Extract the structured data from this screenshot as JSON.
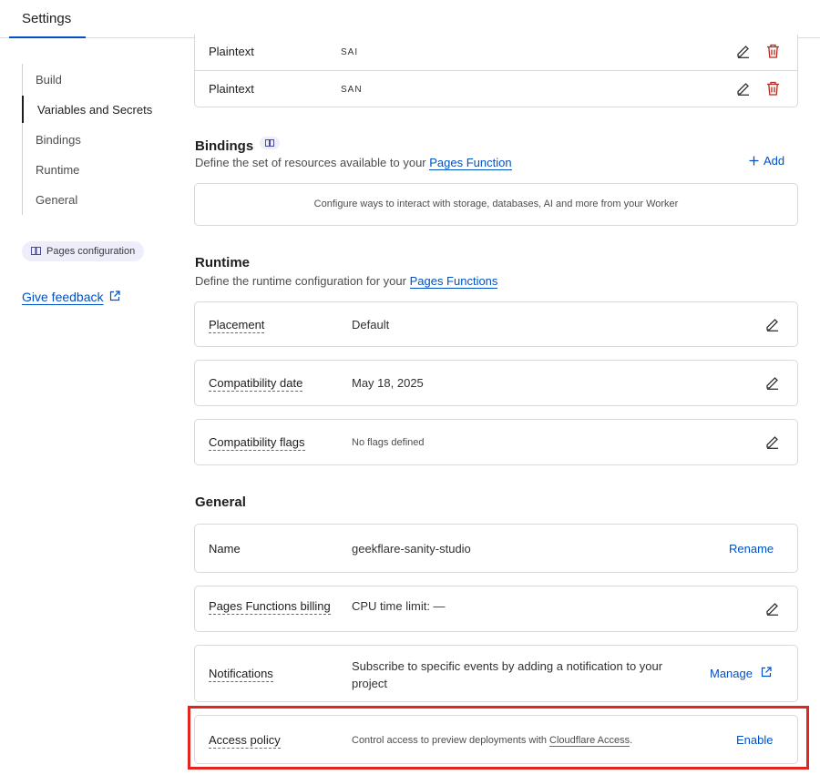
{
  "header": {
    "tab": "Settings"
  },
  "sidebar": {
    "items": [
      {
        "label": "Build",
        "active": false
      },
      {
        "label": "Variables and Secrets",
        "active": true
      },
      {
        "label": "Bindings",
        "active": false
      },
      {
        "label": "Runtime",
        "active": false
      },
      {
        "label": "General",
        "active": false
      }
    ],
    "pages_config": "Pages configuration",
    "feedback": "Give feedback"
  },
  "variables": [
    {
      "type": "Plaintext",
      "name": "SAI"
    },
    {
      "type": "Plaintext",
      "name": "SAN"
    }
  ],
  "bindings": {
    "title": "Bindings",
    "desc_prefix": "Define the set of resources available to your ",
    "desc_link": "Pages Function",
    "add": "Add",
    "empty": "Configure ways to interact with storage, databases, AI and more from your Worker"
  },
  "runtime": {
    "title": "Runtime",
    "desc_prefix": "Define the runtime configuration for your ",
    "desc_link": "Pages Functions",
    "rows": [
      {
        "label": "Placement",
        "value": "Default"
      },
      {
        "label": "Compatibility date",
        "value": "May 18, 2025"
      },
      {
        "label": "Compatibility flags",
        "value": "No flags defined"
      }
    ]
  },
  "general": {
    "title": "General",
    "name_label": "Name",
    "name_value": "geekflare-sanity-studio",
    "rename": "Rename",
    "billing_label": "Pages Functions billing",
    "billing_value": "CPU time limit: —",
    "notifications_label": "Notifications",
    "notifications_value": "Subscribe to specific events by adding a notification to your project",
    "manage": "Manage",
    "access_label": "Access policy",
    "access_prefix": "Control access to preview deployments with ",
    "access_link": "Cloudflare Access",
    "access_suffix": ".",
    "enable": "Enable"
  },
  "colors": {
    "accent": "#0051c3",
    "danger": "#b3261e",
    "highlight": "#e0261f"
  }
}
